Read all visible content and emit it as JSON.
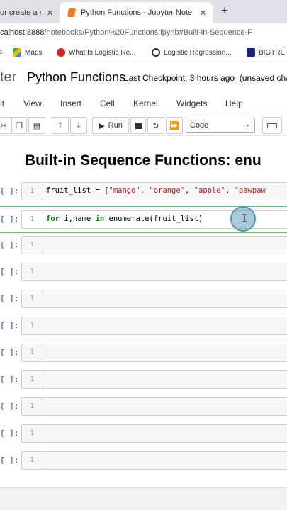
{
  "browser": {
    "tabs": [
      {
        "label": "or create a n"
      },
      {
        "label": "Python Functions - Jupyter Note"
      }
    ],
    "address": {
      "prefix": "calhost:8888",
      "path": "/notebooks/Python%20Functions.ipynb#Built-in-Sequence-F"
    },
    "bookmarks": [
      {
        "label": "s"
      },
      {
        "label": "Maps"
      },
      {
        "label": "What Is Logistic Re..."
      },
      {
        "label": "Logistic Regression..."
      },
      {
        "label": "BIGTRE"
      }
    ]
  },
  "jupyter": {
    "logo_text": "ter",
    "title": "Python Functions",
    "checkpoint": "Last Checkpoint: 3 hours ago",
    "unsaved": "(unsaved cha"
  },
  "menu": {
    "items": [
      "it",
      "View",
      "Insert",
      "Cell",
      "Kernel",
      "Widgets",
      "Help"
    ]
  },
  "toolbar": {
    "run_label": "Run",
    "cell_type": "Code"
  },
  "notebook": {
    "heading": "Built-in Sequence Functions: enu",
    "prompt": "[ ]:",
    "line_number": "1",
    "cell1": {
      "var": "fruit_list = [",
      "s1": "\"mango\"",
      "s2": "\"orange\"",
      "s3": "\"apple\"",
      "s4": "\"pawpaw"
    },
    "cell2": {
      "kw1": "for",
      "mid": " i,name ",
      "kw2": "in",
      "rest": " enumerate(fruit_list)"
    },
    "empty_cells": 9
  }
}
